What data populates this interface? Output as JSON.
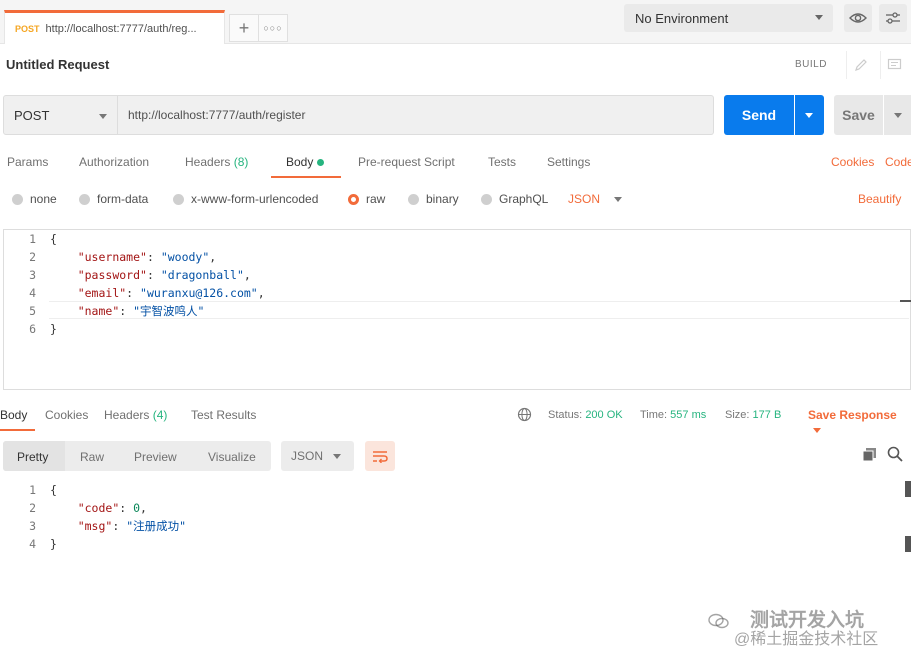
{
  "tabbar": {
    "tab_method": "POST",
    "tab_url": "http://localhost:7777/auth/reg...",
    "environment": "No Environment"
  },
  "request": {
    "title": "Untitled Request",
    "build_label": "BUILD",
    "method": "POST",
    "url": "http://localhost:7777/auth/register",
    "send_label": "Send",
    "save_label": "Save"
  },
  "request_tabs": {
    "params": "Params",
    "authorization": "Authorization",
    "headers": "Headers",
    "headers_count": "(8)",
    "body": "Body",
    "prerequest": "Pre-request Script",
    "tests": "Tests",
    "settings": "Settings",
    "cookies": "Cookies",
    "code": "Code"
  },
  "body_types": {
    "none": "none",
    "form_data": "form-data",
    "urlencoded": "x-www-form-urlencoded",
    "raw": "raw",
    "binary": "binary",
    "graphql": "GraphQL",
    "format": "JSON",
    "beautify": "Beautify"
  },
  "request_body": [
    {
      "num": "1",
      "pre": "{",
      "key": "",
      "sep": "",
      "val": "",
      "post": ""
    },
    {
      "num": "2",
      "pre": "    ",
      "key": "\"username\"",
      "sep": ": ",
      "val": "\"woody\"",
      "post": ","
    },
    {
      "num": "3",
      "pre": "    ",
      "key": "\"password\"",
      "sep": ": ",
      "val": "\"dragonball\"",
      "post": ","
    },
    {
      "num": "4",
      "pre": "    ",
      "key": "\"email\"",
      "sep": ": ",
      "val": "\"wuranxu@126.com\"",
      "post": ","
    },
    {
      "num": "5",
      "pre": "    ",
      "key": "\"name\"",
      "sep": ": ",
      "val": "\"宇智波鸣人\"",
      "post": ""
    },
    {
      "num": "6",
      "pre": "}",
      "key": "",
      "sep": "",
      "val": "",
      "post": ""
    }
  ],
  "response_tabs": {
    "body": "Body",
    "cookies": "Cookies",
    "headers": "Headers",
    "headers_count": "(4)",
    "test_results": "Test Results"
  },
  "response_meta": {
    "status_label": "Status:",
    "status_value": "200 OK",
    "time_label": "Time:",
    "time_value": "557 ms",
    "size_label": "Size:",
    "size_value": "177 B",
    "save_response": "Save Response"
  },
  "view_tabs": {
    "pretty": "Pretty",
    "raw": "Raw",
    "preview": "Preview",
    "visualize": "Visualize",
    "format": "JSON"
  },
  "response_body": [
    {
      "num": "1",
      "pre": "{",
      "key": "",
      "sep": "",
      "val": "",
      "post": "",
      "type": ""
    },
    {
      "num": "2",
      "pre": "    ",
      "key": "\"code\"",
      "sep": ": ",
      "val": "0",
      "post": ",",
      "type": "n"
    },
    {
      "num": "3",
      "pre": "    ",
      "key": "\"msg\"",
      "sep": ": ",
      "val": "\"注册成功\"",
      "post": "",
      "type": "s"
    },
    {
      "num": "4",
      "pre": "}",
      "key": "",
      "sep": "",
      "val": "",
      "post": "",
      "type": ""
    }
  ],
  "watermark": {
    "line1": "测试开发入坑",
    "line2": "@稀土掘金技术社区"
  },
  "colors": {
    "accent": "#f26b3a",
    "send_blue": "#097bed",
    "success_green": "#26b47f"
  }
}
